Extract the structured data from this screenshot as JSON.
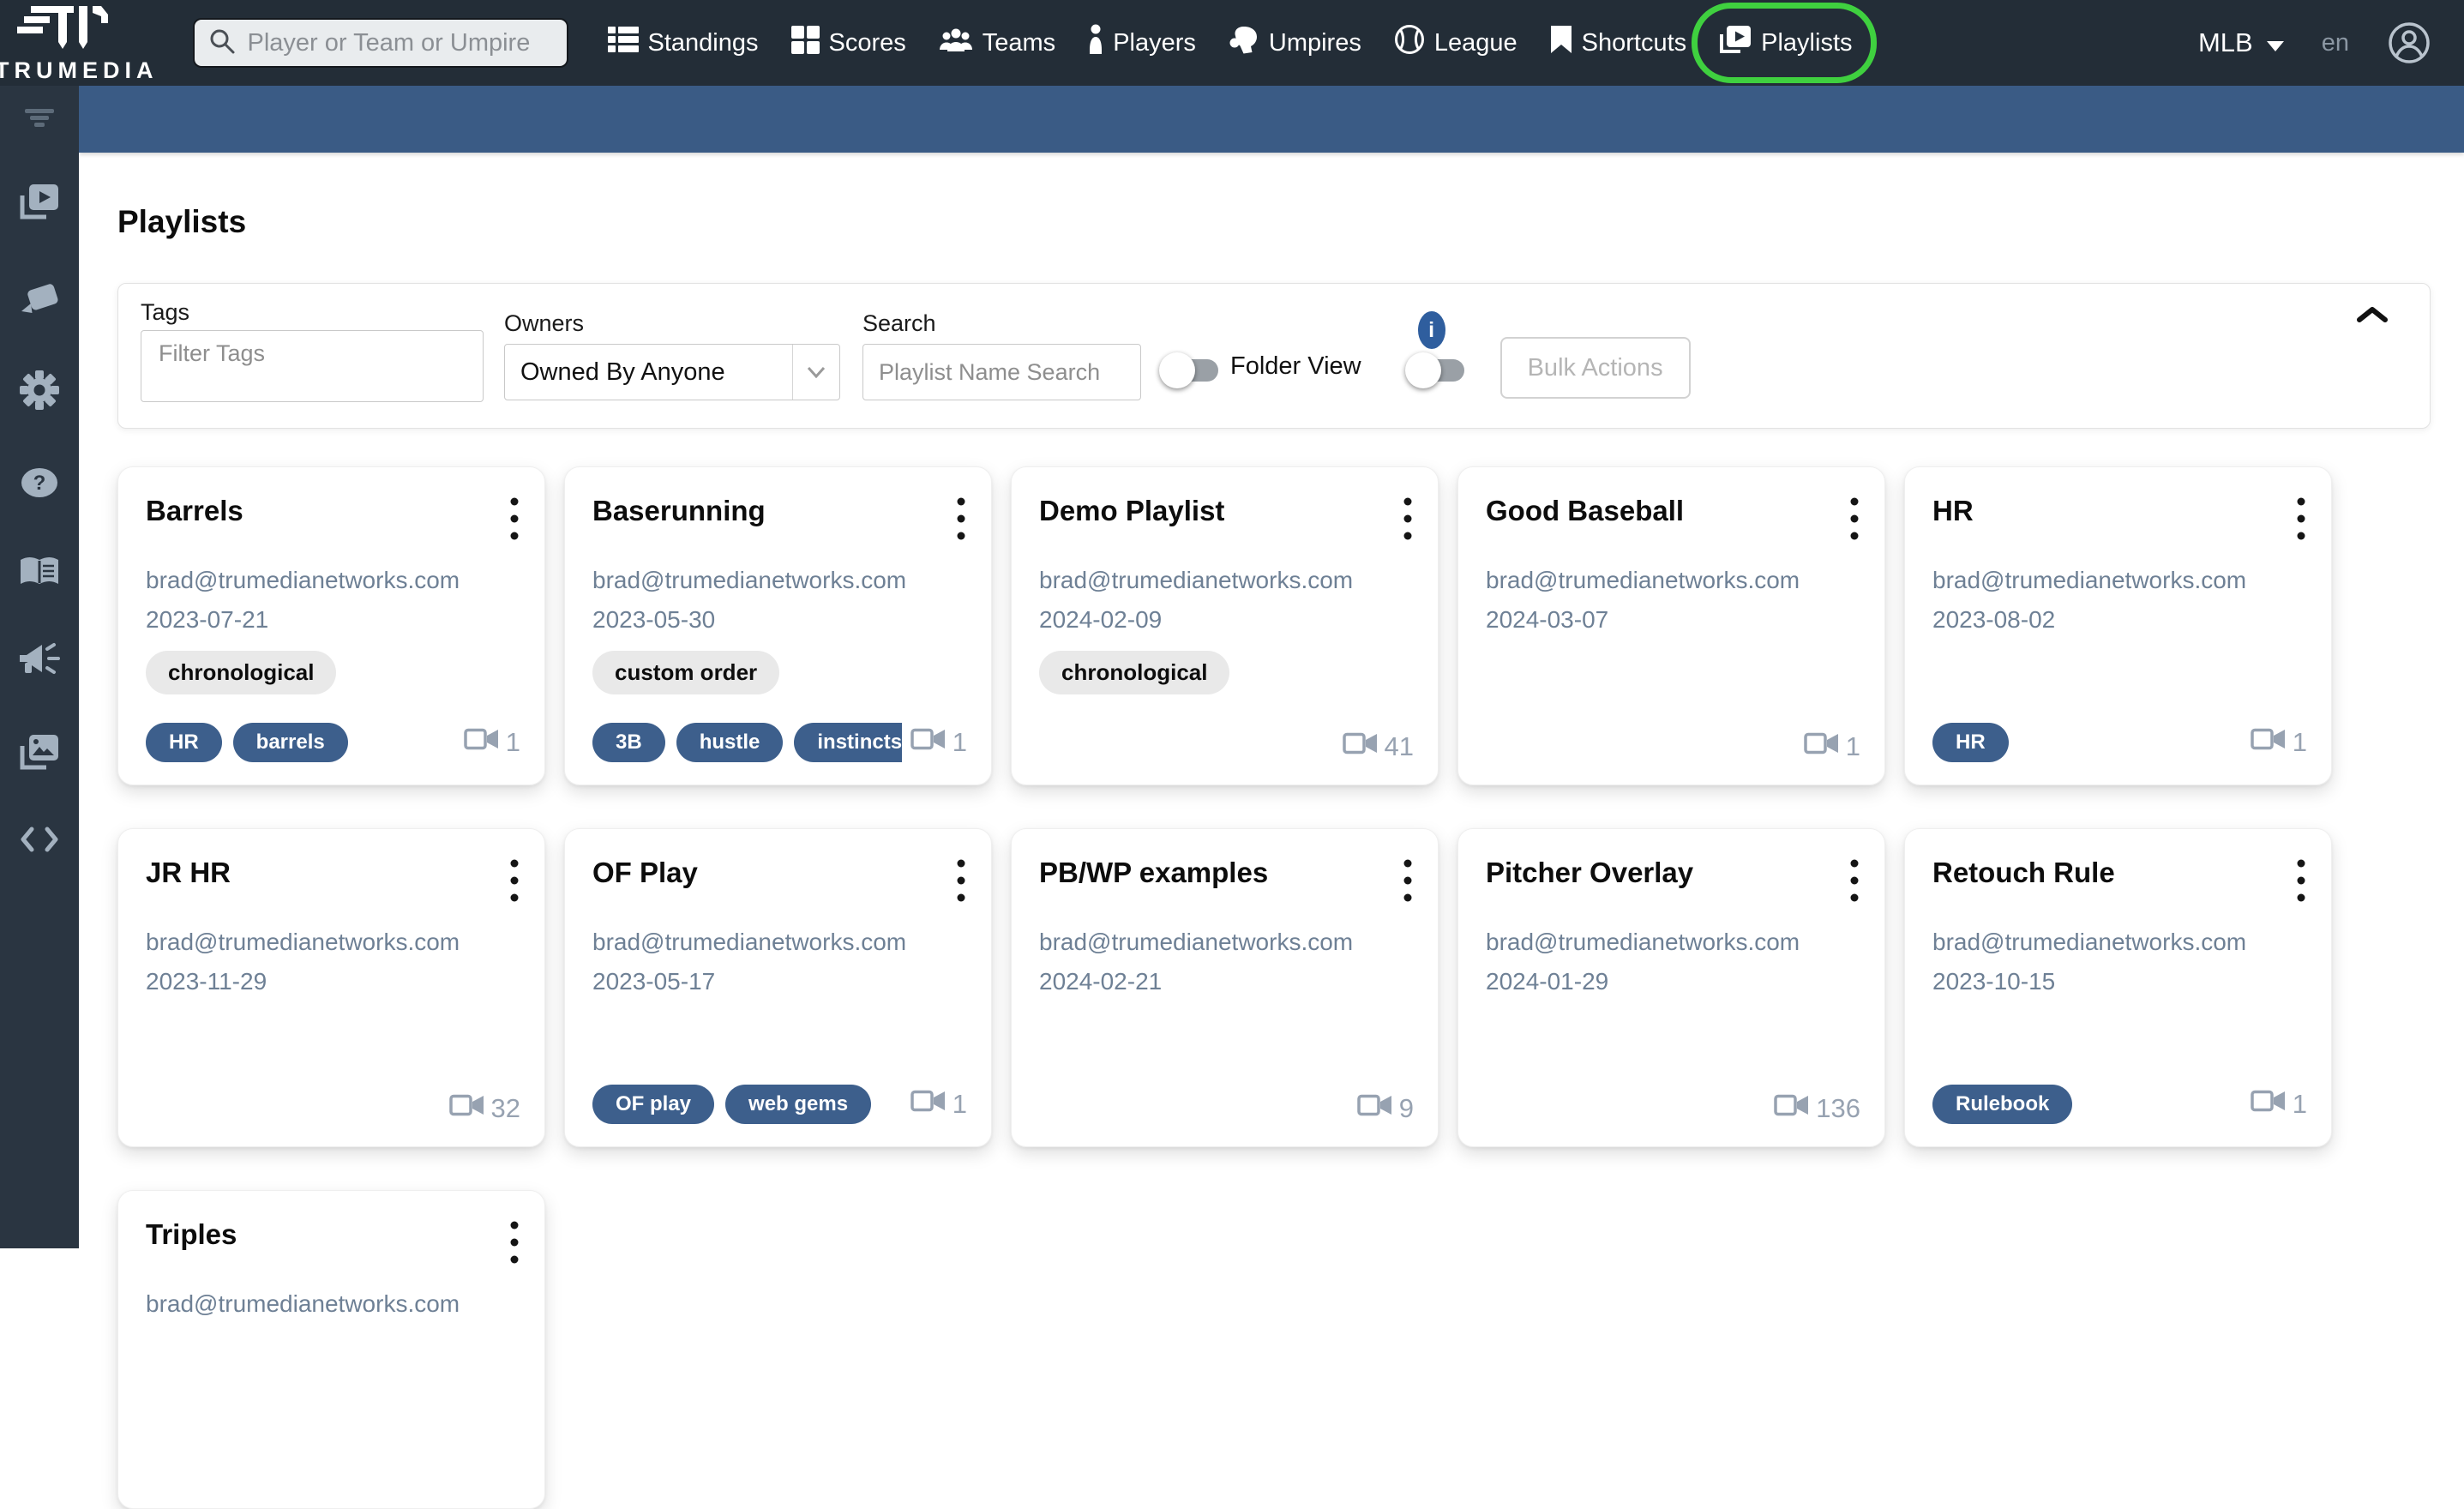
{
  "nav": {
    "logo_text": "TRUMEDIA",
    "search_placeholder": "Player or Team or Umpire",
    "items": [
      {
        "label": "Standings",
        "icon": "standings-list-icon"
      },
      {
        "label": "Scores",
        "icon": "scores-grid-icon"
      },
      {
        "label": "Teams",
        "icon": "teams-people-icon"
      },
      {
        "label": "Players",
        "icon": "player-person-icon"
      },
      {
        "label": "Umpires",
        "icon": "umpire-mitt-icon"
      },
      {
        "label": "League",
        "icon": "league-baseball-icon"
      },
      {
        "label": "Shortcuts",
        "icon": "shortcuts-bookmark-icon"
      },
      {
        "label": "Playlists",
        "icon": "playlists-video-icon",
        "highlighted": true
      }
    ],
    "league": "MLB",
    "language": "en"
  },
  "sidebar": {
    "items": [
      "filter-lines-icon",
      "playlists-video-icon",
      "spray-chart-icon",
      "settings-gear-icon",
      "help-question-icon",
      "glossary-book-icon",
      "announcements-megaphone-icon",
      "media-images-icon",
      "embed-code-icon"
    ]
  },
  "page": {
    "title": "Playlists"
  },
  "filters": {
    "tags_label": "Tags",
    "tags_placeholder": "Filter Tags",
    "owners_label": "Owners",
    "owners_value": "Owned By Anyone",
    "search_label": "Search",
    "search_placeholder": "Playlist Name Search",
    "folder_view_label": "Folder View",
    "bulk_actions_label": "Bulk Actions"
  },
  "playlists": [
    {
      "title": "Barrels",
      "owner": "brad@trumedianetworks.com",
      "date": "2023-07-21",
      "order_tag": "chronological",
      "tags": [
        "HR",
        "barrels"
      ],
      "video_count": "1"
    },
    {
      "title": "Baserunning",
      "owner": "brad@trumedianetworks.com",
      "date": "2023-05-30",
      "order_tag": "custom order",
      "tags": [
        "3B",
        "hustle",
        "instincts"
      ],
      "video_count": "1"
    },
    {
      "title": "Demo Playlist",
      "owner": "brad@trumedianetworks.com",
      "date": "2024-02-09",
      "order_tag": "chronological",
      "tags": [],
      "video_count": "41"
    },
    {
      "title": "Good Baseball",
      "owner": "brad@trumedianetworks.com",
      "date": "2024-03-07",
      "order_tag": "",
      "tags": [],
      "video_count": "1"
    },
    {
      "title": "HR",
      "owner": "brad@trumedianetworks.com",
      "date": "2023-08-02",
      "order_tag": "",
      "tags": [
        "HR"
      ],
      "video_count": "1"
    },
    {
      "title": "JR HR",
      "owner": "brad@trumedianetworks.com",
      "date": "2023-11-29",
      "order_tag": "",
      "tags": [],
      "video_count": "32"
    },
    {
      "title": "OF Play",
      "owner": "brad@trumedianetworks.com",
      "date": "2023-05-17",
      "order_tag": "",
      "tags": [
        "OF play",
        "web gems"
      ],
      "video_count": "1"
    },
    {
      "title": "PB/WP examples",
      "owner": "brad@trumedianetworks.com",
      "date": "2024-02-21",
      "order_tag": "",
      "tags": [],
      "video_count": "9"
    },
    {
      "title": "Pitcher Overlay",
      "owner": "brad@trumedianetworks.com",
      "date": "2024-01-29",
      "order_tag": "",
      "tags": [],
      "video_count": "136"
    },
    {
      "title": "Retouch Rule",
      "owner": "brad@trumedianetworks.com",
      "date": "2023-10-15",
      "order_tag": "",
      "tags": [
        "Rulebook"
      ],
      "video_count": "1"
    },
    {
      "title": "Triples",
      "owner": "brad@trumedianetworks.com",
      "date": "",
      "order_tag": "",
      "tags": [],
      "video_count": ""
    }
  ],
  "colors": {
    "nav_bg": "#232d37",
    "sidebar_bg": "#2a3541",
    "banner_blue": "#3a5b85",
    "pill_blue": "#3d5f8c",
    "muted_text": "#6e8095",
    "count_text": "#97a2b1",
    "highlight_green": "#3fd03f",
    "info_blue": "#2f5e9e"
  }
}
